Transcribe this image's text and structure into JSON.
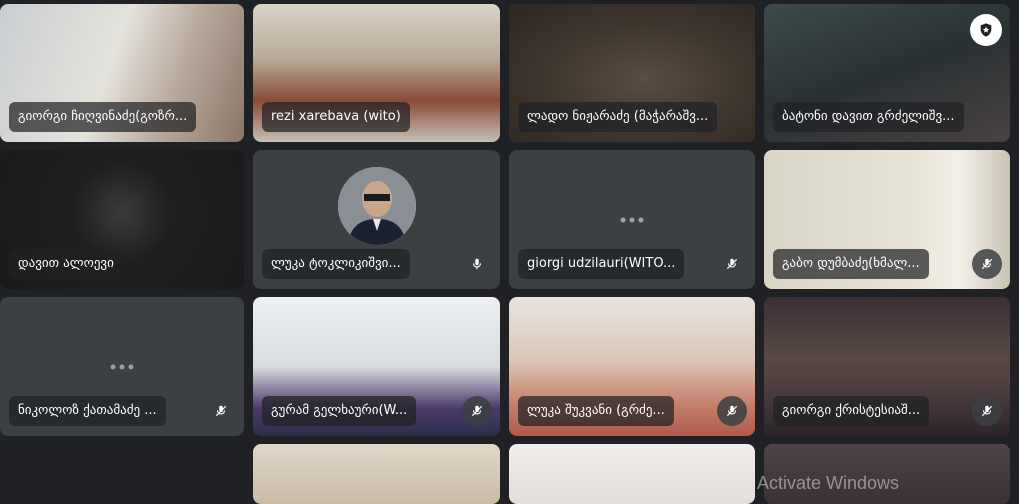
{
  "participants": [
    {
      "name": "გიორგი ჩიღვინაძე(გოზრ..."
    },
    {
      "name": "rezi xarebava (wito)"
    },
    {
      "name": "ლადო ნიჟარაძე (მაჭარაშვ..."
    },
    {
      "name": "ბატონი დავით გრძელიშვ..."
    },
    {
      "name": "დავით ალოევი"
    },
    {
      "name": "ლუკა ტოკლიკიშვი..."
    },
    {
      "name": "giorgi udzilauri(WITO..."
    },
    {
      "name": "გაბო დუმბაძე(ხმალ..."
    },
    {
      "name": "ნიკოლოზ ქათამაძე ..."
    },
    {
      "name": "გურამ გელხაური(W..."
    },
    {
      "name": "ლუკა შუკვანი (გრძე..."
    },
    {
      "name": "გიორგი ქრისტესიაშ..."
    }
  ],
  "icons": {
    "mic_off": "mic-off-icon",
    "mic_on": "mic-on-icon",
    "pin": "shield-pin-icon",
    "more": "more-dots-icon"
  },
  "colors": {
    "background": "#202124",
    "tile": "#3c4043",
    "speaking_border": "#34a853",
    "chip_bg": "#202124"
  },
  "watermark": "Activate Windows"
}
